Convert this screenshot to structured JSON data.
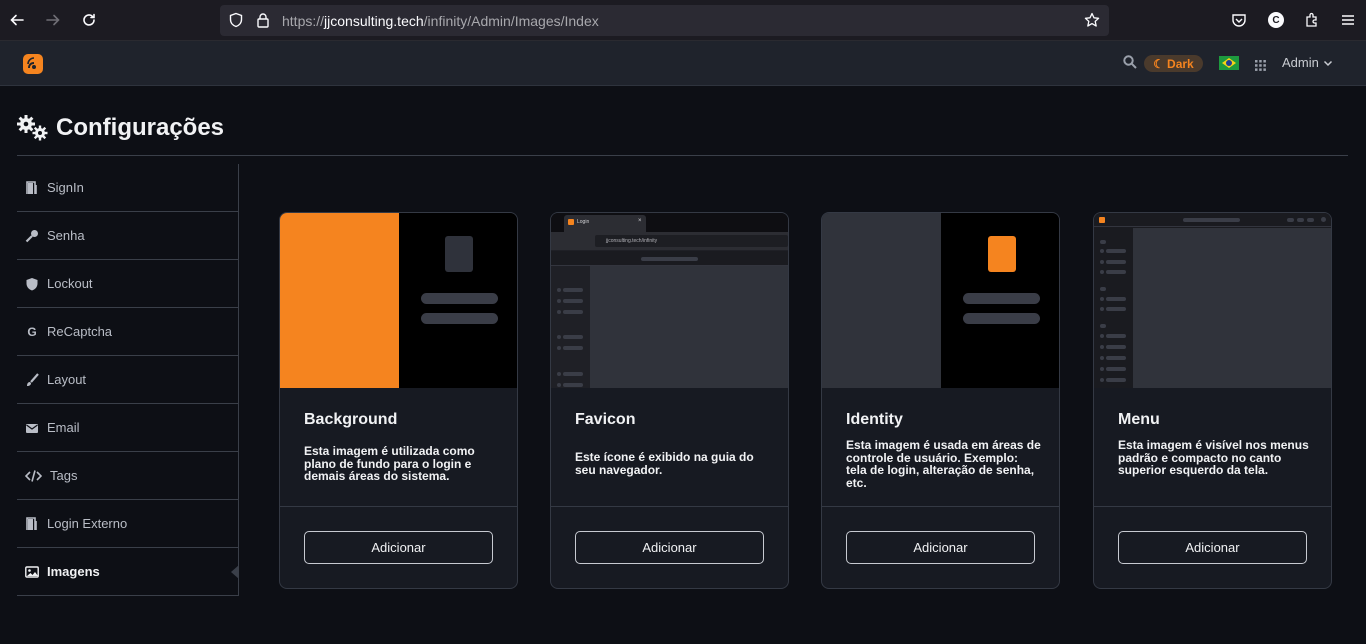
{
  "browser": {
    "url_scheme": "https://",
    "url_host": "jjconsulting.tech",
    "url_path": "/infinity/Admin/Images/Index",
    "profile_initial": "C"
  },
  "header": {
    "theme_label": "Dark",
    "user_label": "Admin",
    "accent_color": "#f5841f"
  },
  "page": {
    "title": "Configurações"
  },
  "sidebar": {
    "items": [
      {
        "label": "SignIn",
        "icon": "door-icon"
      },
      {
        "label": "Senha",
        "icon": "key-icon"
      },
      {
        "label": "Lockout",
        "icon": "shield-icon"
      },
      {
        "label": "ReCaptcha",
        "icon": "google-icon"
      },
      {
        "label": "Layout",
        "icon": "brush-icon"
      },
      {
        "label": "Email",
        "icon": "envelope-icon"
      },
      {
        "label": "Tags",
        "icon": "code-icon"
      },
      {
        "label": "Login Externo",
        "icon": "door-icon"
      },
      {
        "label": "Imagens",
        "icon": "image-icon",
        "active": true
      }
    ]
  },
  "cards": [
    {
      "title": "Background",
      "desc": "Esta imagem é utilizada como plano de fundo para o login e demais áreas do sistema.",
      "button": "Adicionar"
    },
    {
      "title": "Favicon",
      "desc": "Este ícone é exibido na guia do seu navegador.",
      "button": "Adicionar",
      "thumb_tab": "Login",
      "thumb_url": "jjconsulting.tech/infinity"
    },
    {
      "title": "Identity",
      "desc": "Esta imagem é usada em áreas de controle de usuário. Exemplo: tela de login, alteração de senha, etc.",
      "button": "Adicionar"
    },
    {
      "title": "Menu",
      "desc": "Esta imagem é visível nos menus padrão e compacto no canto superior esquerdo da tela.",
      "button": "Adicionar"
    }
  ]
}
